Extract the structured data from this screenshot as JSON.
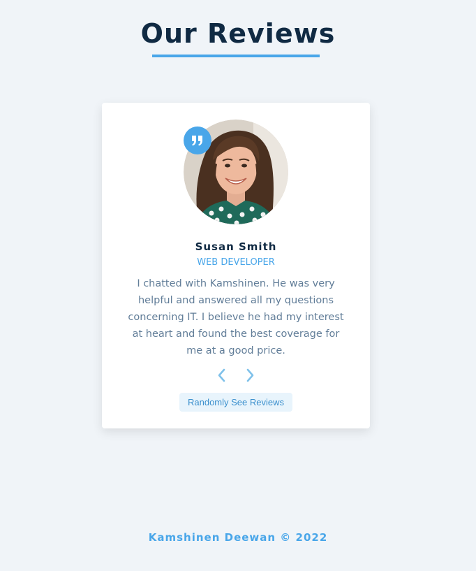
{
  "header": {
    "title": "Our Reviews"
  },
  "review": {
    "name": "Susan Smith",
    "job": "WEB DEVELOPER",
    "text": "I chatted with Kamshinen. He was very helpful and answered all my questions concerning IT. I believe he had my interest at heart and found the best coverage for me at a good price.",
    "avatar_icon": "person-photo",
    "quote_icon": "quote-icon"
  },
  "controls": {
    "prev_icon": "chevron-left-icon",
    "next_icon": "chevron-right-icon",
    "random_label": "Randomly See Reviews"
  },
  "footer": {
    "text": "Kamshinen Deewan © 2022"
  },
  "colors": {
    "background": "#f0f4f8",
    "accent": "#49a6e9",
    "title": "#102a43",
    "body_text": "#617d98",
    "card": "#ffffff"
  }
}
